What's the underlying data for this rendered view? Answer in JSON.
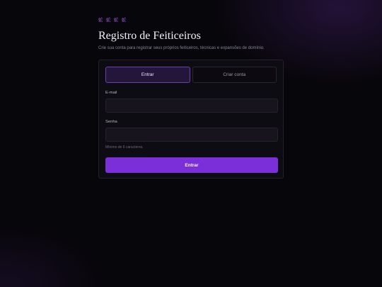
{
  "header": {
    "glyphs": "蛇 蛇 蛇 蛇",
    "title": "Registro de Feiticeiros",
    "subtitle": "Crie sua conta para registrar seus próprios feiticeiros, técnicas e expansões de domínio."
  },
  "tabs": [
    {
      "label": "Entrar",
      "active": true
    },
    {
      "label": "Criar conta",
      "active": false
    }
  ],
  "form": {
    "email_label": "E-mail",
    "email_value": "",
    "password_label": "Senha",
    "password_value": "",
    "password_hint": "Mínimo de 6 caracteres.",
    "submit_label": "Entrar"
  },
  "colors": {
    "accent": "#7b2fd8",
    "background": "#07060a",
    "card": "#0e0c13"
  }
}
